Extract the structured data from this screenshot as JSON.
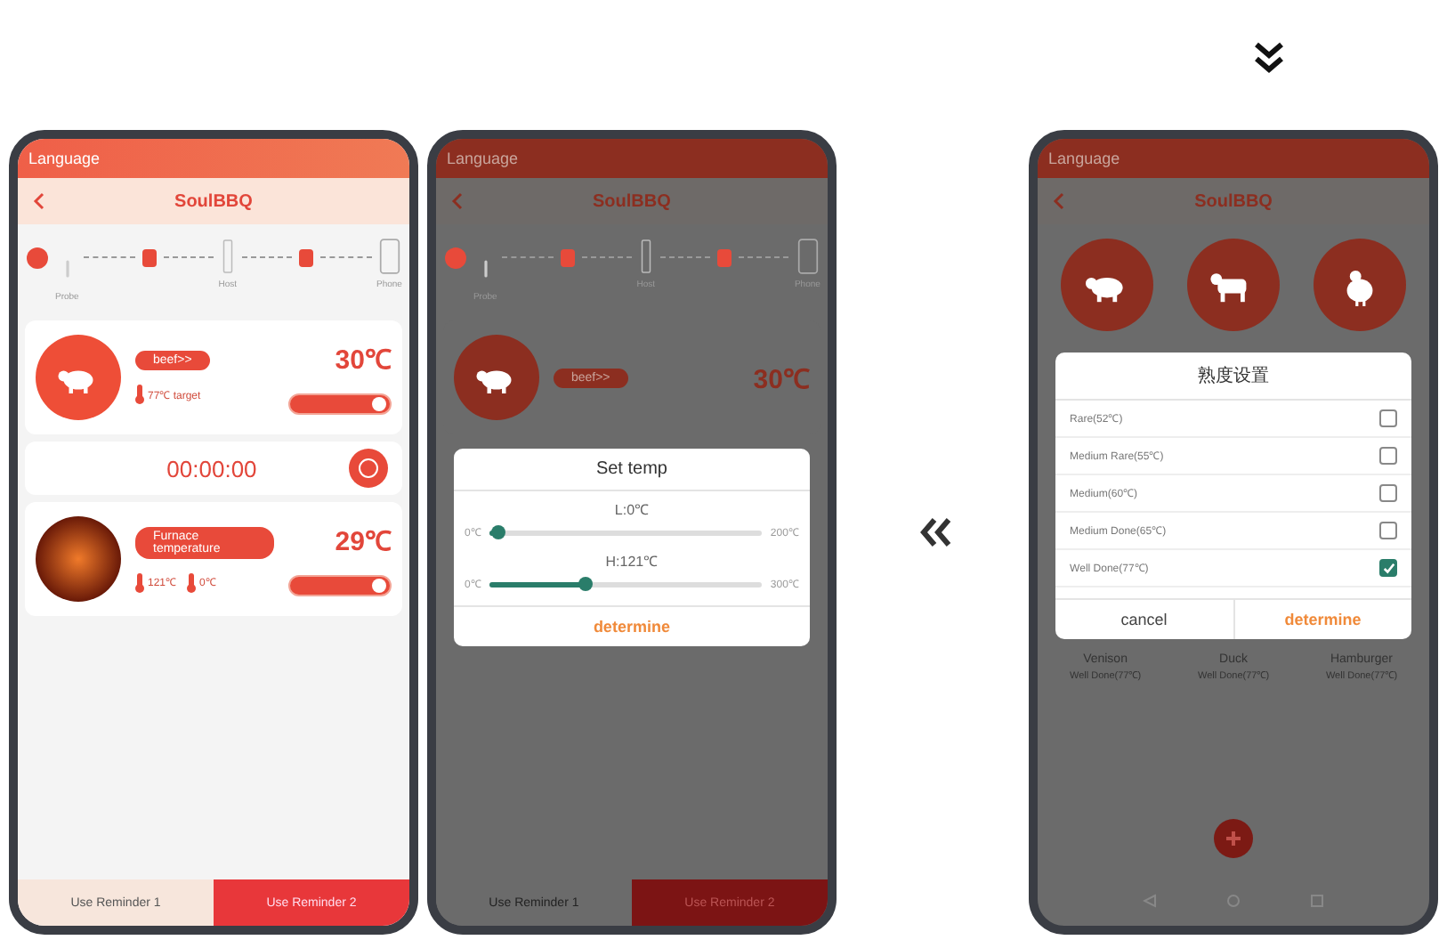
{
  "phones": [
    {
      "kind": "monitor",
      "dimmed": false,
      "status_title": "Language",
      "nav_title": "SoulBBQ",
      "steps": [
        "Probe",
        "Host",
        "Phone"
      ],
      "probes": [
        {
          "kind": "meat",
          "label": "beef>>",
          "temp": "30℃",
          "targets": [
            "77℃ target"
          ],
          "on": true
        },
        {
          "kind": "fire",
          "label": "Furnace temperature",
          "temp": "29℃",
          "targets": [
            "121℃",
            "0℃"
          ],
          "on": true
        }
      ],
      "timer": "00:00:00",
      "tabs": [
        {
          "label": "Use Reminder 1",
          "selected": false
        },
        {
          "label": "Use Reminder 2",
          "selected": true
        }
      ]
    },
    {
      "kind": "set_temp",
      "dimmed": true,
      "status_title": "Language",
      "nav_title": "SoulBBQ",
      "steps": [
        "Probe",
        "Host",
        "Phone"
      ],
      "probes": [
        {
          "kind": "meat",
          "label": "beef>>",
          "temp": "30℃"
        }
      ],
      "dialog": {
        "title": "Set temp",
        "sliders": [
          {
            "label": "L:0℃",
            "min": "0℃",
            "max": "200℃",
            "level": 0.03
          },
          {
            "label": "H:121℃",
            "min": "0℃",
            "max": "300℃",
            "level": 0.35
          }
        ],
        "buttons": [
          "determine"
        ]
      },
      "tabs": [
        {
          "label": "Use Reminder 1",
          "selected": false
        },
        {
          "label": "Use Reminder 2",
          "selected": true
        }
      ]
    },
    {
      "kind": "doneness",
      "dimmed": true,
      "status_title": "Language",
      "nav_title": "SoulBBQ",
      "animals": [
        {
          "kind": "pig"
        },
        {
          "kind": "cow"
        },
        {
          "kind": "chicken"
        }
      ],
      "dialog": {
        "title": "熟度设置",
        "options": [
          {
            "label": "Rare(52℃)",
            "checked": false
          },
          {
            "label": "Medium Rare(55℃)",
            "checked": false
          },
          {
            "label": "Medium(60℃)",
            "checked": false
          },
          {
            "label": "Medium Done(65℃)",
            "checked": false
          },
          {
            "label": "Well Done(77℃)",
            "checked": true
          }
        ],
        "buttons": [
          "cancel",
          "determine"
        ]
      },
      "foods": [
        {
          "name": "Venison",
          "level": "Well Done(77℃)"
        },
        {
          "name": "Duck",
          "level": "Well Done(77℃)"
        },
        {
          "name": "Hamburger",
          "level": "Well Done(77℃)"
        }
      ]
    }
  ]
}
